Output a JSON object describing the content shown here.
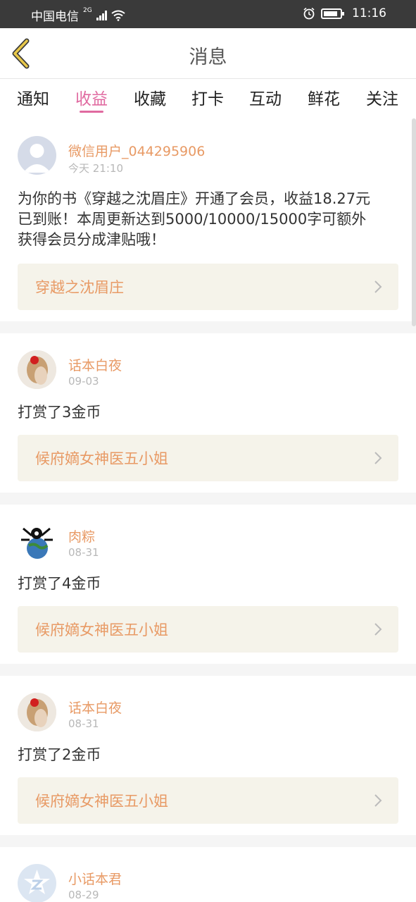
{
  "status_bar": {
    "carrier": "中国电信",
    "network": "2G",
    "time": "11:16"
  },
  "nav": {
    "title": "消息",
    "back_icon": "chevron-left-icon"
  },
  "tabs": [
    {
      "label": "通知",
      "active": false
    },
    {
      "label": "收益",
      "active": true
    },
    {
      "label": "收藏",
      "active": false
    },
    {
      "label": "打卡",
      "active": false
    },
    {
      "label": "互动",
      "active": false
    },
    {
      "label": "鲜花",
      "active": false
    },
    {
      "label": "关注",
      "active": false
    }
  ],
  "messages": [
    {
      "user": "微信用户_044295906",
      "time": "今天 21:10",
      "avatar": "default-avatar",
      "content_lines": [
        "为你的书《穿越之沈眉庄》开通了会员，收益18.27元",
        "已到账！本周更新达到5000/10000/15000字可额外",
        "获得会员分成津贴哦！"
      ],
      "book": "穿越之沈眉庄"
    },
    {
      "user": "话本白夜",
      "time": "09-03",
      "avatar": "girl-photo-avatar",
      "content_lines": [
        "打赏了3金币"
      ],
      "book": "候府嫡女神医五小姐"
    },
    {
      "user": "肉粽",
      "time": "08-31",
      "avatar": "globe-cartoon-avatar",
      "content_lines": [
        "打赏了4金币"
      ],
      "book": "候府嫡女神医五小姐"
    },
    {
      "user": "话本白夜",
      "time": "08-31",
      "avatar": "girl-photo-avatar",
      "content_lines": [
        "打赏了2金币"
      ],
      "book": "候府嫡女神医五小姐"
    },
    {
      "user": "小话本君",
      "time": "08-29",
      "avatar": "app-logo-avatar"
    }
  ],
  "colors": {
    "accent": "#e06aa0",
    "username": "#e89a65",
    "book_link_bg": "#f5f3ea",
    "status_bar": "#3a3a3a",
    "back_icon": "#e8c84a"
  }
}
